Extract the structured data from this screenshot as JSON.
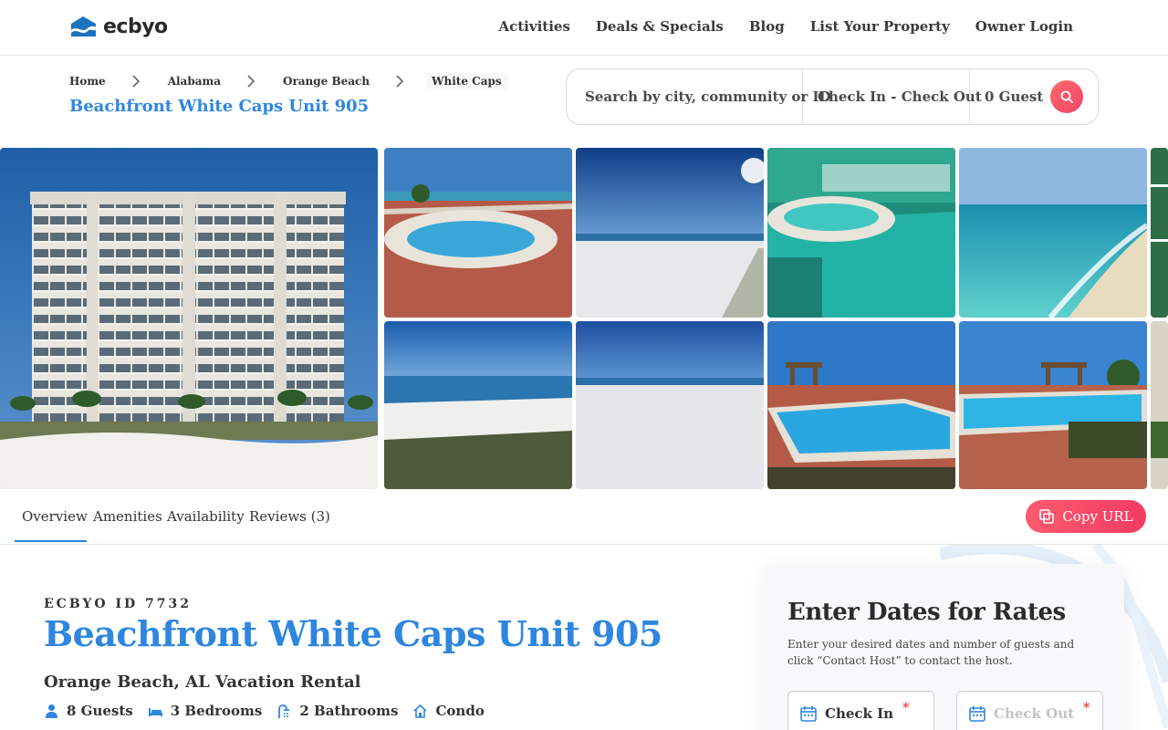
{
  "header": {
    "logo_text": "ecbyo",
    "nav": [
      "Activities",
      "Deals & Specials",
      "Blog",
      "List Your Property",
      "Owner Login"
    ]
  },
  "breadcrumb": [
    "Home",
    "Alabama",
    "Orange Beach",
    "White Caps"
  ],
  "page_subtitle": "Beachfront White Caps Unit 905",
  "search": {
    "placeholder": "Search by city, community or ID",
    "dates": "Check In - Check Out",
    "guests": "0 Guest"
  },
  "tabs": [
    "Overview",
    "Amenities",
    "Availability",
    "Reviews (3)"
  ],
  "copy_url_label": "Copy URL",
  "listing": {
    "id_label": "ECBYO ID 7732",
    "title": "Beachfront White Caps Unit 905",
    "location": "Orange Beach, AL Vacation Rental",
    "features": {
      "guests": "8 Guests",
      "bedrooms": "3 Bedrooms",
      "bathrooms": "2 Bathrooms",
      "type": "Condo"
    }
  },
  "rates": {
    "title": "Enter Dates for Rates",
    "description": "Enter your desired dates and number of guests and click “Contact Host” to contact the host.",
    "check_in": "Check In",
    "check_out": "Check Out",
    "required_mark": "*"
  },
  "colors": {
    "accent_blue": "#2e86de",
    "accent_red": "#f0446a"
  }
}
